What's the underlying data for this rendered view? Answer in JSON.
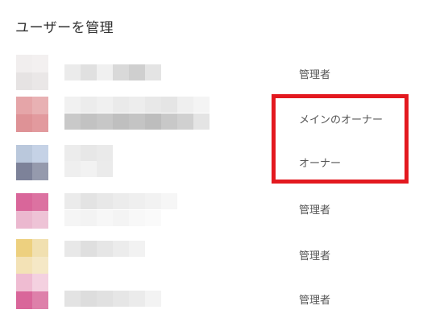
{
  "page": {
    "title": "ユーザーを管理"
  },
  "users": [
    {
      "role": "管理者"
    },
    {
      "role": "メインのオーナー"
    },
    {
      "role": "オーナー"
    },
    {
      "role": "管理者"
    },
    {
      "role": "管理者"
    },
    {
      "role": "管理者"
    }
  ],
  "colors": {
    "highlight": "#e3191f",
    "avatar_red": "#e29a9e",
    "avatar_blue": "#7d8299",
    "avatar_pink": "#d9669a",
    "avatar_yellow": "#edd07f",
    "blur_gray": "#d5d5d5"
  }
}
